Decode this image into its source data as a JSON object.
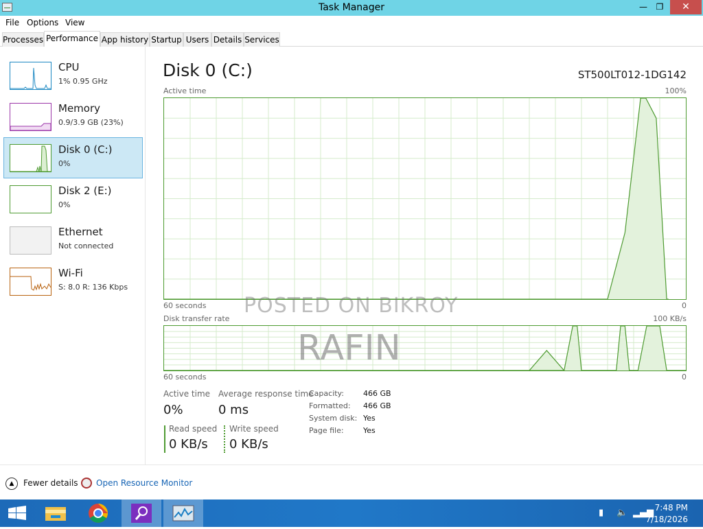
{
  "window": {
    "title": "Task Manager"
  },
  "menu": [
    "File",
    "Options",
    "View"
  ],
  "tabs": [
    "Processes",
    "Performance",
    "App history",
    "Startup",
    "Users",
    "Details",
    "Services"
  ],
  "active_tab": "Performance",
  "sidebar": [
    {
      "title": "CPU",
      "subtitle": "1% 0.95 GHz",
      "color": "#1a87c2"
    },
    {
      "title": "Memory",
      "subtitle": "0.9/3.9 GB (23%)",
      "color": "#9b35a8"
    },
    {
      "title": "Disk 0 (C:)",
      "subtitle": "0%",
      "color": "#4d9a30",
      "selected": true
    },
    {
      "title": "Disk 2 (E:)",
      "subtitle": "0%",
      "color": "#4d9a30"
    },
    {
      "title": "Ethernet",
      "subtitle": "Not connected",
      "color": "#bbbbbb"
    },
    {
      "title": "Wi-Fi",
      "subtitle": "S: 8.0  R: 136 Kbps",
      "color": "#b8620f"
    }
  ],
  "detail": {
    "title": "Disk 0 (C:)",
    "model": "ST500LT012-1DG142",
    "active_time_graph": {
      "label": "Active time",
      "max_label": "100%",
      "left_label": "60 seconds",
      "right_label": "0",
      "chart_data": {
        "type": "area",
        "x_range": [
          60,
          0
        ],
        "ylim": [
          0,
          100
        ],
        "x": [
          60,
          9,
          7,
          5.2,
          4.6,
          3.4,
          2.2,
          2.0
        ],
        "values": [
          0,
          0,
          33,
          100,
          100,
          90,
          0,
          0
        ],
        "grid": true
      }
    },
    "transfer_graph": {
      "label": "Disk transfer rate",
      "max_label": "100 KB/s",
      "left_label": "60 seconds",
      "right_label": "0",
      "chart_data": {
        "type": "area",
        "x_range": [
          60,
          0
        ],
        "ylim": [
          0,
          100
        ],
        "series": [
          {
            "x": [
              60,
              18,
              16,
              14,
              12,
              10,
              8,
              6,
              4,
              2.2,
              0
            ],
            "values": [
              0,
              0,
              45,
              0,
              0,
              0,
              0,
              0,
              0,
              0,
              0
            ]
          },
          {
            "x": [
              60,
              14,
              13,
              12.5,
              12,
              8,
              7.5,
              7,
              6.5,
              5.5,
              4.5,
              3,
              2.2,
              1.5,
              0
            ],
            "values": [
              0,
              0,
              100,
              100,
              0,
              0,
              100,
              100,
              0,
              0,
              100,
              100,
              0,
              0,
              0
            ]
          }
        ],
        "grid": true
      }
    },
    "stats": {
      "active_time": {
        "label": "Active time",
        "value": "0%"
      },
      "avg_response": {
        "label": "Average response time",
        "value": "0 ms"
      },
      "read_speed": {
        "label": "Read speed",
        "value": "0 KB/s"
      },
      "write_speed": {
        "label": "Write speed",
        "value": "0 KB/s"
      }
    },
    "info": [
      {
        "key": "Capacity:",
        "value": "466 GB"
      },
      {
        "key": "Formatted:",
        "value": "466 GB"
      },
      {
        "key": "System disk:",
        "value": "Yes"
      },
      {
        "key": "Page file:",
        "value": "Yes"
      }
    ]
  },
  "watermark": {
    "line1": "POSTED ON BIKROY",
    "line2": "RAFIN"
  },
  "footer": {
    "fewer_details": "Fewer details",
    "open_resource_monitor": "Open Resource Monitor"
  },
  "taskbar": {
    "apps": [
      "start-icon",
      "file-explorer-icon",
      "chrome-icon",
      "search-app-icon",
      "task-manager-icon"
    ],
    "time": "7:48 PM",
    "date": "7/18/2026"
  }
}
